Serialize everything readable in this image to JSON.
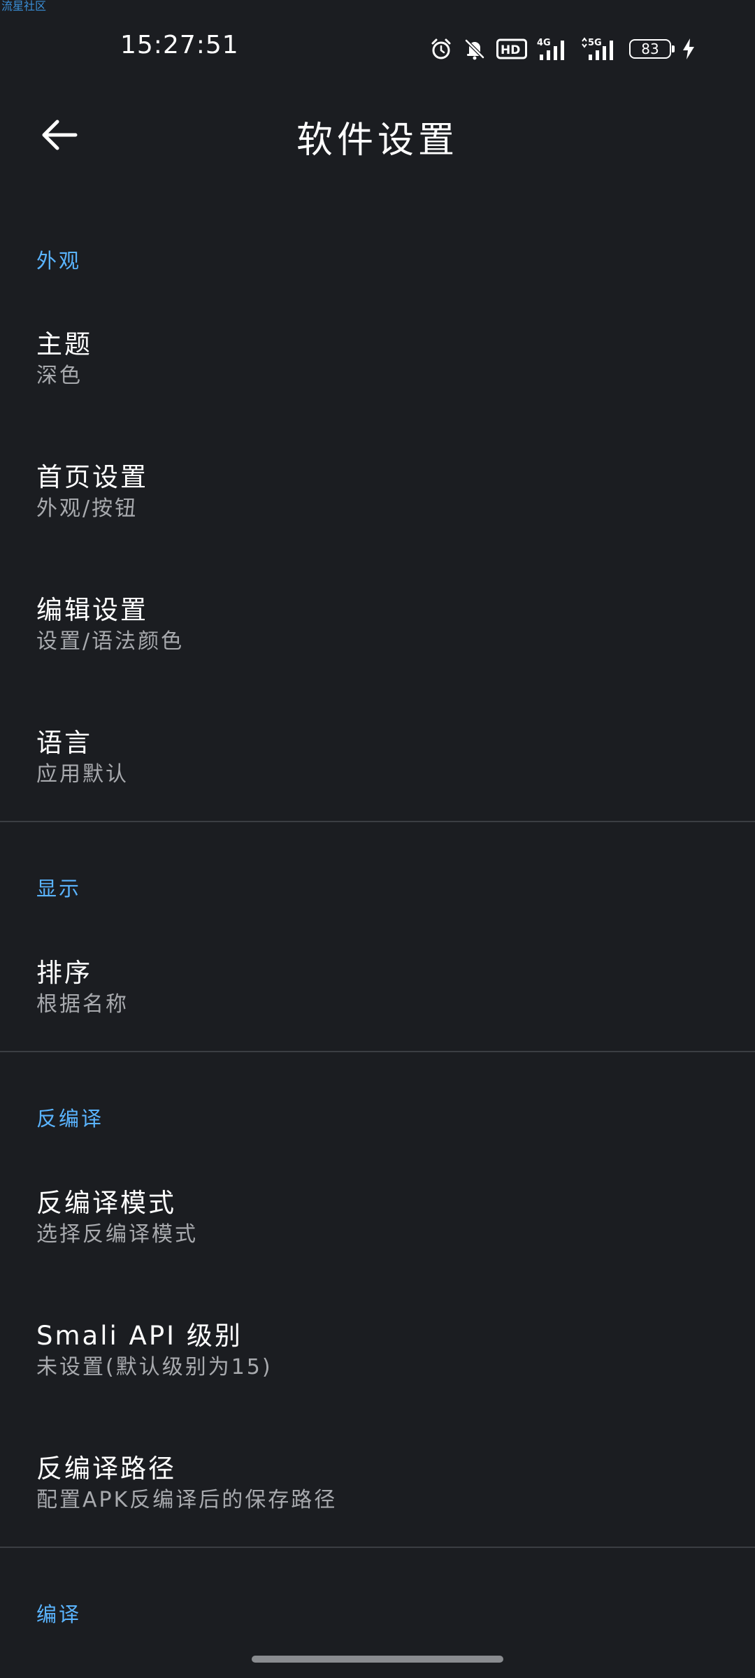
{
  "watermark": "流星社区",
  "status_bar": {
    "time": "15:27:51",
    "network_1": "4G",
    "network_2": "5G",
    "hd_badge": "HD",
    "battery": "83",
    "icons": [
      "alarm-icon",
      "mute-bell-icon",
      "hd-voice-icon",
      "signal-4g-icon",
      "signal-5g-icon",
      "battery-icon",
      "charging-icon"
    ]
  },
  "app_bar": {
    "title": "软件设置",
    "back_icon": "arrow-left-icon"
  },
  "sections": {
    "appearance": {
      "header": "外观",
      "items": [
        {
          "title": "主题",
          "summary": "深色"
        },
        {
          "title": "首页设置",
          "summary": "外观/按钮"
        },
        {
          "title": "编辑设置",
          "summary": "设置/语法颜色"
        },
        {
          "title": "语言",
          "summary": "应用默认"
        }
      ]
    },
    "display": {
      "header": "显示",
      "items": [
        {
          "title": "排序",
          "summary": "根据名称"
        }
      ]
    },
    "decompile": {
      "header": "反编译",
      "items": [
        {
          "title": "反编译模式",
          "summary": "选择反编译模式"
        },
        {
          "title": "Smali API 级别",
          "summary": "未设置(默认级别为15)"
        },
        {
          "title": "反编译路径",
          "summary": "配置APK反编译后的保存路径"
        }
      ]
    },
    "compile": {
      "header": "编译"
    }
  },
  "colors": {
    "background": "#1b1d21",
    "accent": "#5ab4ff",
    "primary_text": "#ffffff",
    "secondary_text": "#a8aaae",
    "divider": "#3b3e43"
  }
}
